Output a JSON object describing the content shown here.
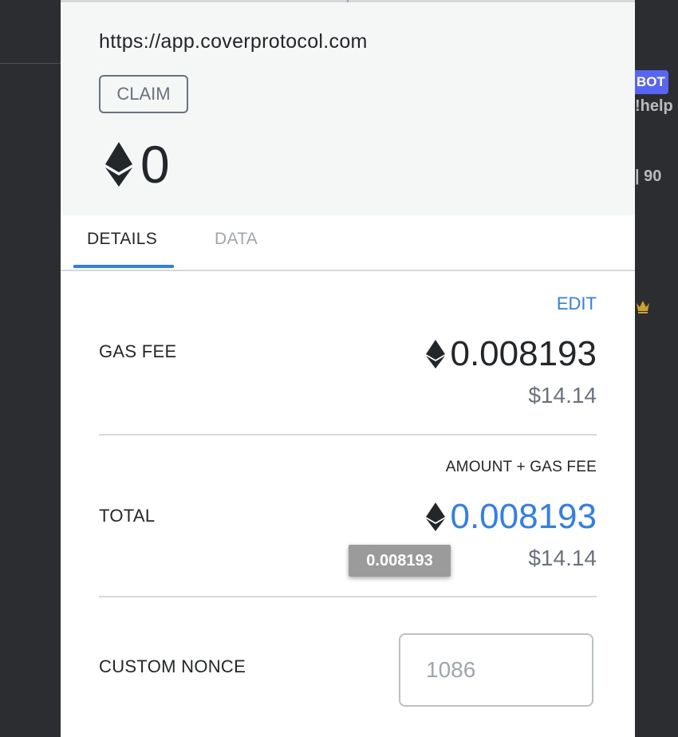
{
  "background": {
    "bot_badge": "BOT",
    "help_text": "!help",
    "number_text": "| 90"
  },
  "header": {
    "origin": "https://app.coverprotocol.com",
    "method": "CLAIM",
    "value": "0"
  },
  "tabs": [
    {
      "label": "DETAILS",
      "active": true
    },
    {
      "label": "DATA",
      "active": false
    }
  ],
  "details": {
    "edit_label": "EDIT",
    "gas_fee": {
      "label": "GAS FEE",
      "eth": "0.008193",
      "fiat": "$14.14"
    },
    "total": {
      "label": "TOTAL",
      "subheading": "AMOUNT + GAS FEE",
      "eth": "0.008193",
      "fiat": "$14.14",
      "tooltip": "0.008193"
    },
    "nonce": {
      "label": "CUSTOM NONCE",
      "placeholder": "1086"
    }
  },
  "colors": {
    "accent": "#2f80ed",
    "text": "#24272a",
    "muted": "#6a737d"
  }
}
